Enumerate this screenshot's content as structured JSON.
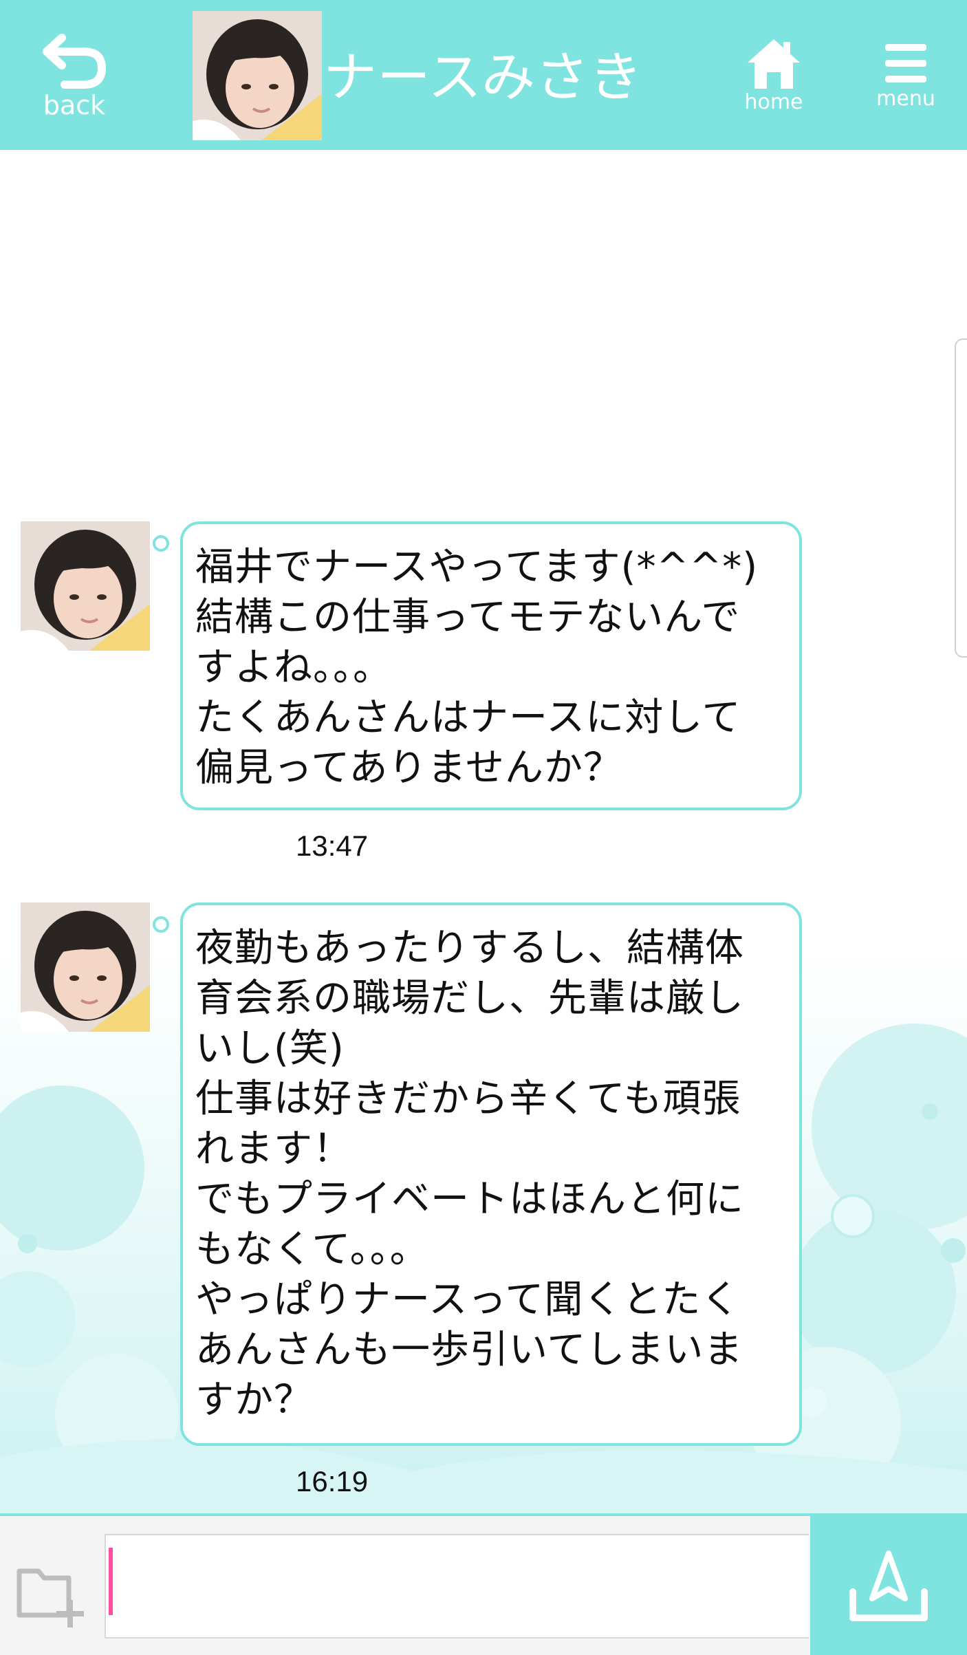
{
  "header": {
    "back_label": "back",
    "title": "ナースみさき",
    "home_label": "home",
    "menu_label": "menu",
    "bg_color": "#7fe3df"
  },
  "messages": [
    {
      "text": "福井でナースやってます(*^^*)\n結構この仕事ってモテないんで\nすよね。。。\nたくあんさんはナースに対して\n偏見ってありませんか？",
      "time": "13:47"
    },
    {
      "text": "夜勤もあったりするし、結構体\n育会系の職場だし、先輩は厳し\nいし(笑)\n仕事は好きだから辛くても頑張\nれます！\nでもプライベートはほんと何に\nもなくて。。。\nやっぱりナースって聞くとたく\nあんさんも一歩引いてしまいま\nすか？",
      "time": "16:19"
    }
  ],
  "input": {
    "value": "",
    "placeholder": ""
  },
  "icons": {
    "back": "back-arrow-icon",
    "home": "house-icon",
    "menu": "hamburger-icon",
    "attach": "folder-plus-icon",
    "send": "send-arrow-icon"
  },
  "colors": {
    "accent": "#7fe3df",
    "caret": "#ff4fa0",
    "bubble_border": "#7fe3df"
  }
}
